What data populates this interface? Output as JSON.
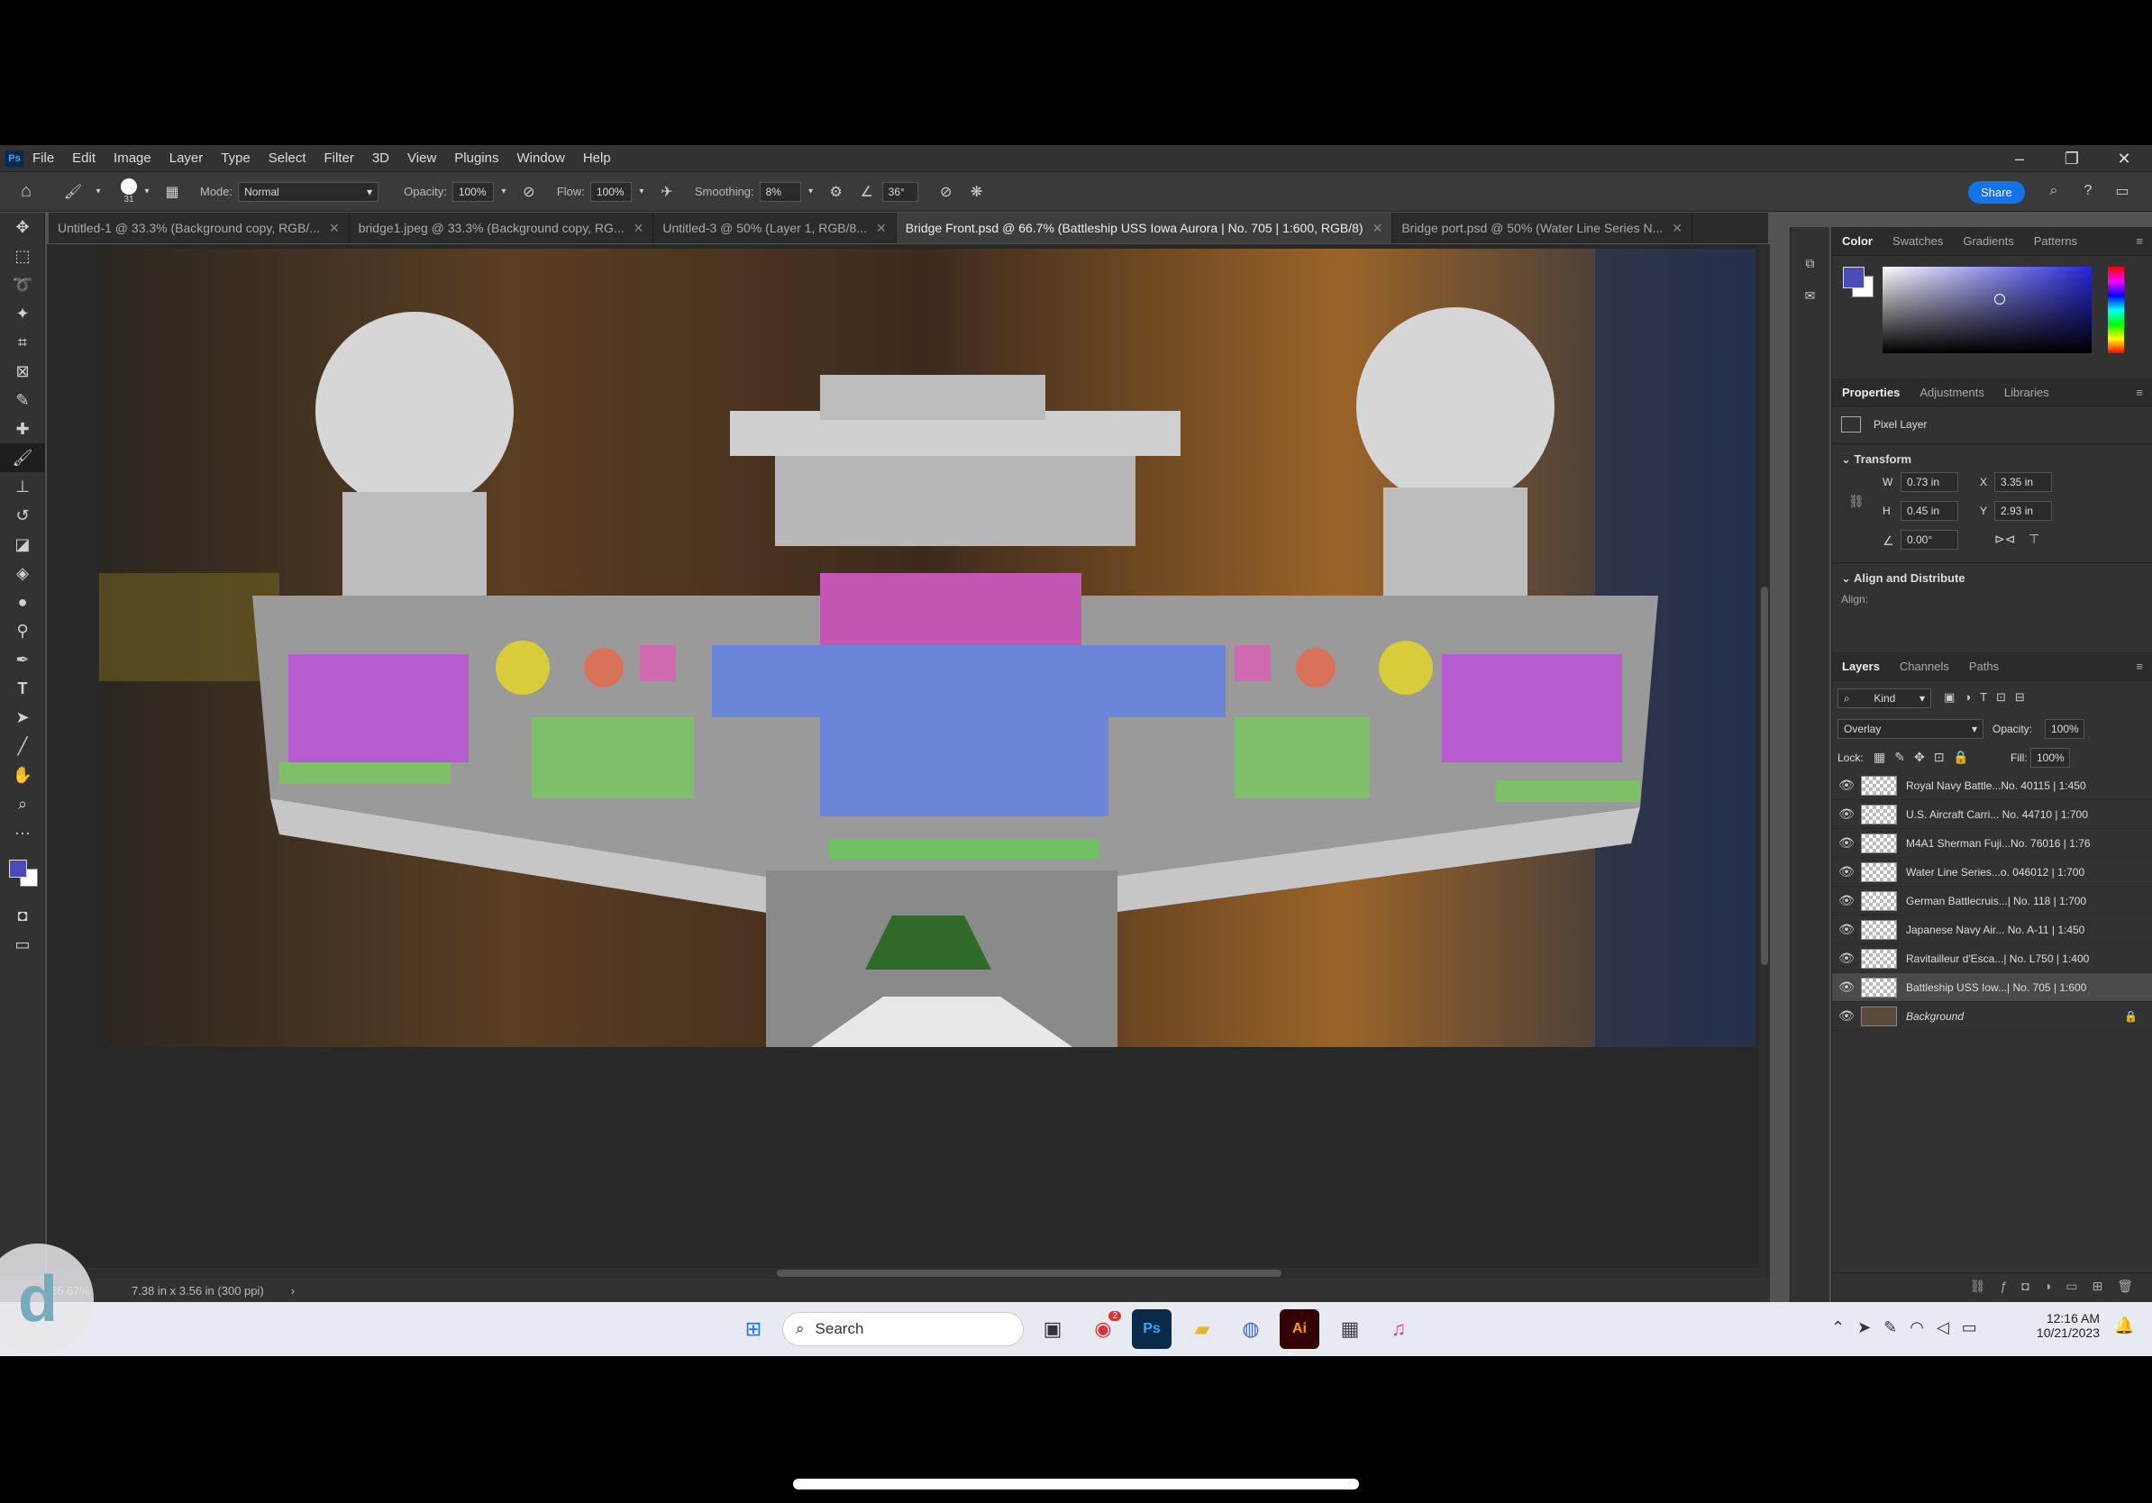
{
  "app": {
    "logo": "Ps",
    "menu": [
      "File",
      "Edit",
      "Image",
      "Layer",
      "Type",
      "Select",
      "Filter",
      "3D",
      "View",
      "Plugins",
      "Window",
      "Help"
    ]
  },
  "options": {
    "brush_size": "31",
    "mode_label": "Mode:",
    "mode_value": "Normal",
    "opacity_label": "Opacity:",
    "opacity_value": "100%",
    "flow_label": "Flow:",
    "flow_value": "100%",
    "smoothing_label": "Smoothing:",
    "smoothing_value": "8%",
    "angle_value": "36°",
    "share_label": "Share"
  },
  "tabs": [
    {
      "label": "Untitled-1 @ 33.3% (Background copy, RGB/...",
      "active": false
    },
    {
      "label": "bridge1.jpeg @ 33.3% (Background copy, RG...",
      "active": false
    },
    {
      "label": "Untitled-3 @ 50% (Layer 1, RGB/8...",
      "active": false
    },
    {
      "label": "Bridge Front.psd @ 66.7% (Battleship USS Iowa  Aurora | No. 705 | 1:600, RGB/8)",
      "active": true
    },
    {
      "label": "Bridge port.psd @ 50% (Water Line Series N...",
      "active": false
    }
  ],
  "status": {
    "zoom": "66.67%",
    "doc_size": "7.38 in x 3.56 in (300 ppi)"
  },
  "color_panel": {
    "tabs": [
      "Color",
      "Swatches",
      "Gradients",
      "Patterns"
    ],
    "foreground": "#4a4ab8",
    "background": "#ffffff"
  },
  "properties": {
    "tabs": [
      "Properties",
      "Adjustments",
      "Libraries"
    ],
    "layer_type": "Pixel Layer",
    "transform_title": "Transform",
    "w_label": "W",
    "w_value": "0.73 in",
    "h_label": "H",
    "h_value": "0.45 in",
    "x_label": "X",
    "x_value": "3.35 in",
    "y_label": "Y",
    "y_value": "2.93 in",
    "angle_value": "0.00°",
    "align_title": "Align and Distribute",
    "align_label": "Align:"
  },
  "layers_panel": {
    "tabs": [
      "Layers",
      "Channels",
      "Paths"
    ],
    "filter_value": "Kind",
    "blend_mode": "Overlay",
    "opacity_label": "Opacity:",
    "opacity_value": "100%",
    "lock_label": "Lock:",
    "fill_label": "Fill:",
    "fill_value": "100%",
    "layers": [
      {
        "name": "Royal Navy Battle...No. 40115 | 1:450",
        "selected": false
      },
      {
        "name": "U.S. Aircraft Carri... No. 44710 | 1:700",
        "selected": false
      },
      {
        "name": "M4A1 Sherman Fuji...No. 76016 | 1:76",
        "selected": false
      },
      {
        "name": "Water Line Series...o. 046012 | 1:700",
        "selected": false
      },
      {
        "name": "German Battlecruis...| No. 118 | 1:700",
        "selected": false
      },
      {
        "name": "Japanese Navy Air... No. A-11 | 1:450",
        "selected": false
      },
      {
        "name": "Ravitailleur d'Esca...| No. L750 | 1:400",
        "selected": false
      },
      {
        "name": "Battleship USS Iow...| No. 705 | 1:600",
        "selected": true
      },
      {
        "name": "Background",
        "selected": false
      }
    ]
  },
  "taskbar": {
    "search_placeholder": "Search",
    "time": "12:16 AM",
    "date": "10/21/2023",
    "chrome_badge": "2"
  },
  "watermark": "d"
}
